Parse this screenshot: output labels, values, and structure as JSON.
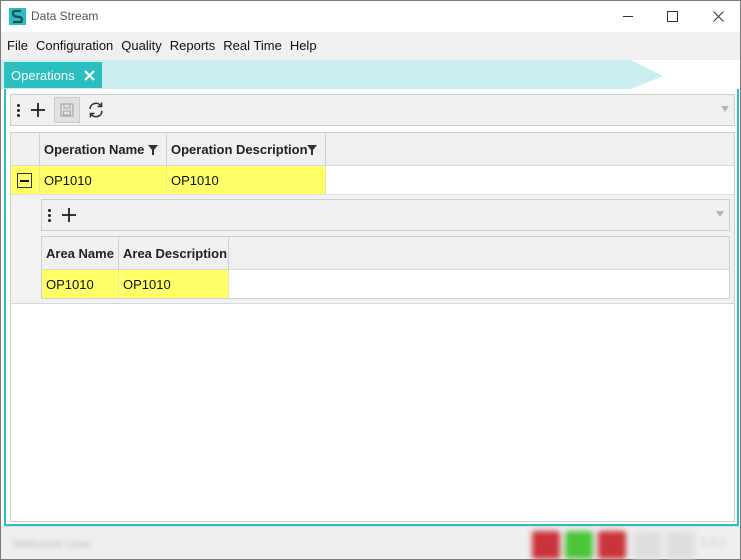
{
  "window": {
    "title": "Data Stream"
  },
  "menu": [
    "File",
    "Configuration",
    "Quality",
    "Reports",
    "Real Time",
    "Help"
  ],
  "tabs": [
    {
      "label": "Operations",
      "active": true
    }
  ],
  "master_grid": {
    "columns": [
      "Operation Name",
      "Operation Description"
    ],
    "rows": [
      {
        "cells": [
          "OP1010",
          "OP1010"
        ],
        "expanded": true
      }
    ]
  },
  "detail_grid": {
    "columns": [
      "Area Name",
      "Area Description"
    ],
    "rows": [
      {
        "cells": [
          "OP1010",
          "OP1010"
        ]
      }
    ]
  },
  "status_bar": {
    "text": "Welcome User",
    "version": "1.0.0",
    "indicators": [
      {
        "name": "red",
        "color": "#c9333a"
      },
      {
        "name": "green",
        "color": "#4cc43a"
      },
      {
        "name": "red",
        "color": "#c9333a"
      }
    ]
  },
  "colors": {
    "accent": "#2bbfbf",
    "highlight": "#ffff66"
  }
}
